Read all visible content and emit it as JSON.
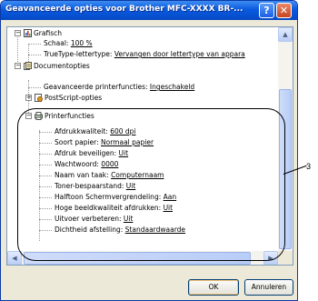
{
  "window": {
    "title": "Geavanceerde opties voor Brother MFC-XXXX   BR-...",
    "help_label": "?",
    "close_label": "✕"
  },
  "tree": {
    "graphics_label": "Grafisch",
    "scale_label": "Schaal: ",
    "scale_value": "100 %",
    "truetype_label": "TrueType-lettertype: ",
    "truetype_value": "Vervangen door lettertype van appara",
    "document_label": "Documentopties",
    "advanced_label": "Geavanceerde printerfuncties: ",
    "advanced_value": "Ingeschakeld",
    "postscript_label": "PostScript-opties",
    "printer_label": "Printerfuncties",
    "features": [
      {
        "label": "Afdrukkwaliteit: ",
        "value": "600 dpi"
      },
      {
        "label": "Soort papier: ",
        "value": "Normaal papier"
      },
      {
        "label": "Afdruk beveiligen: ",
        "value": "Uit"
      },
      {
        "label": "Wachtwoord: ",
        "value": "0000"
      },
      {
        "label": "Naam van taak: ",
        "value": "Computernaam"
      },
      {
        "label": "Toner-bespaarstand: ",
        "value": "Uit"
      },
      {
        "label": "Halftoon Schermvergrendeling: ",
        "value": "Aan"
      },
      {
        "label": "Hoge beeldkwaliteit afdrukken: ",
        "value": "Uit"
      },
      {
        "label": "Uitvoer verbeteren: ",
        "value": "Uit"
      },
      {
        "label": "Dichtheid afstelling: ",
        "value": "Standaardwaarde"
      }
    ]
  },
  "callout": "3",
  "buttons": {
    "ok": "OK",
    "cancel": "Annuleren"
  },
  "colors": {
    "titlebar": "#0a5ade",
    "dialog_bg": "#ece9d8",
    "close": "#c8451f"
  }
}
